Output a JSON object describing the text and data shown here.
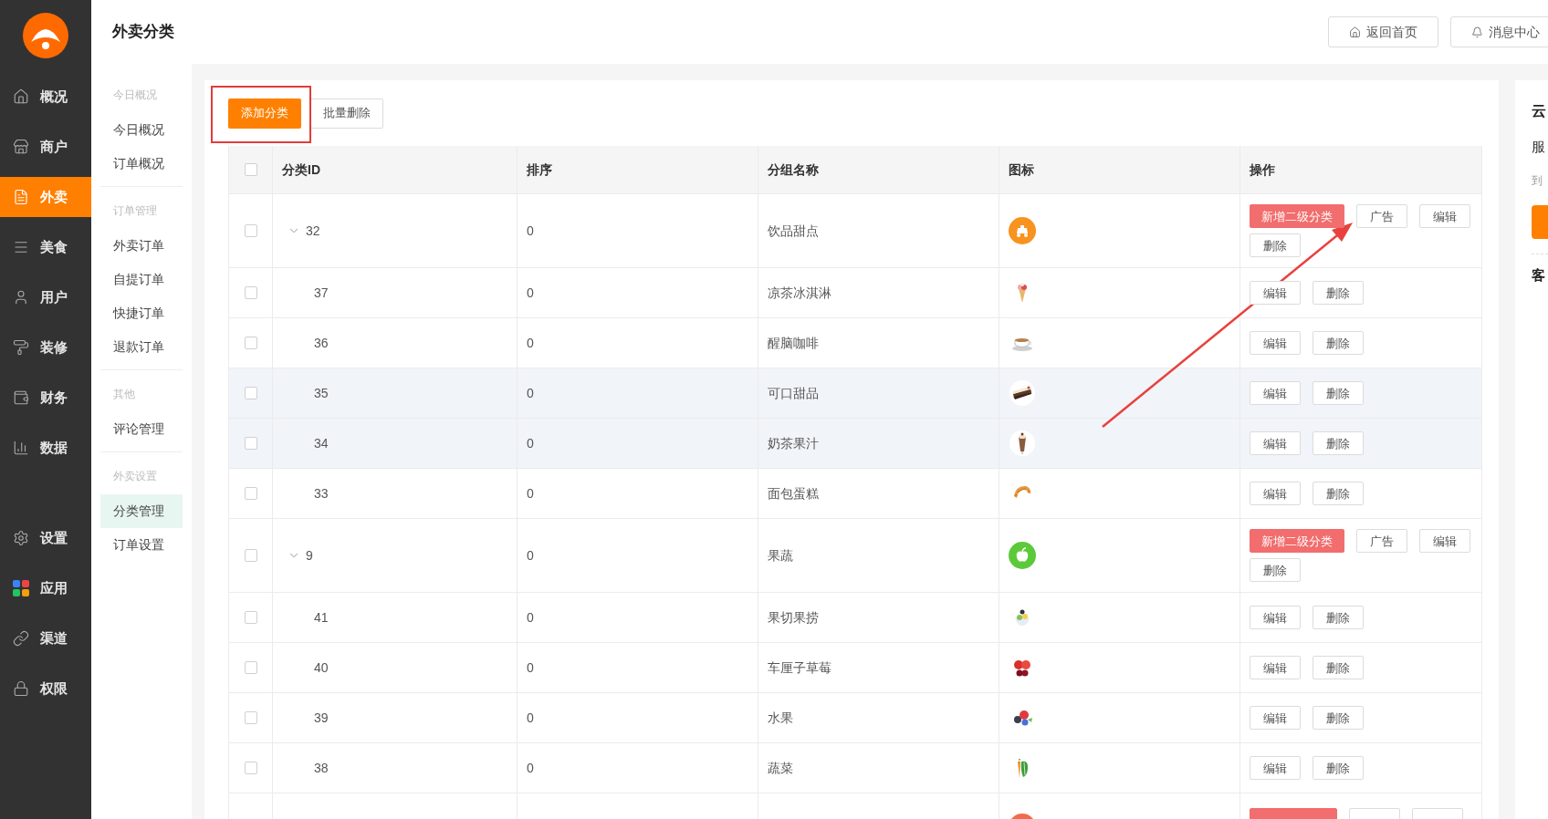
{
  "sidebar": {
    "items": [
      {
        "label": "概况",
        "selected": false
      },
      {
        "label": "商户",
        "selected": false
      },
      {
        "label": "外卖",
        "selected": true
      },
      {
        "label": "美食",
        "selected": false
      },
      {
        "label": "用户",
        "selected": false
      },
      {
        "label": "装修",
        "selected": false
      },
      {
        "label": "财务",
        "selected": false
      },
      {
        "label": "数据",
        "selected": false
      }
    ],
    "bottom_items": [
      {
        "label": "设置",
        "selected": false
      },
      {
        "label": "应用",
        "selected": false
      },
      {
        "label": "渠道",
        "selected": false
      },
      {
        "label": "权限",
        "selected": false
      }
    ]
  },
  "header": {
    "title": "外卖分类",
    "buttons": [
      "返回首页",
      "消息中心"
    ]
  },
  "subnav": [
    {
      "title": "今日概况",
      "items": [
        {
          "label": "今日概况",
          "selected": false
        },
        {
          "label": "订单概况",
          "selected": false
        }
      ]
    },
    {
      "title": "订单管理",
      "items": [
        {
          "label": "外卖订单",
          "selected": false
        },
        {
          "label": "自提订单",
          "selected": false
        },
        {
          "label": "快捷订单",
          "selected": false
        },
        {
          "label": "退款订单",
          "selected": false
        }
      ]
    },
    {
      "title": "其他",
      "items": [
        {
          "label": "评论管理",
          "selected": false
        }
      ]
    },
    {
      "title": "外卖设置",
      "items": [
        {
          "label": "分类管理",
          "selected": true
        },
        {
          "label": "订单设置",
          "selected": false
        }
      ]
    }
  ],
  "toolbar": {
    "add_button": "添加分类",
    "batch_delete_button": "批量删除"
  },
  "table": {
    "columns": [
      "分类ID",
      "排序",
      "分组名称",
      "图标",
      "操作"
    ],
    "header_checked": false,
    "rows": [
      {
        "id": "32",
        "sort": "0",
        "name": "饮品甜点",
        "checked": false,
        "expanded": true,
        "highlighted": false,
        "icon": {
          "kind": "scooter",
          "color": "#f7931e"
        },
        "actions": [
          {
            "label": "新增二级分类",
            "kind": "primary"
          },
          {
            "label": "广告",
            "kind": "default"
          },
          {
            "label": "编辑",
            "kind": "default"
          },
          {
            "label": "删除",
            "kind": "default"
          }
        ],
        "children": [
          {
            "id": "37",
            "sort": "0",
            "name": "凉茶冰淇淋",
            "checked": false,
            "highlighted": false,
            "icon": {
              "kind": "picture"
            },
            "actions": [
              {
                "label": "编辑",
                "kind": "default"
              },
              {
                "label": "删除",
                "kind": "default"
              }
            ]
          },
          {
            "id": "36",
            "sort": "0",
            "name": "醒脑咖啡",
            "checked": false,
            "highlighted": false,
            "icon": {
              "kind": "picture"
            },
            "actions": [
              {
                "label": "编辑",
                "kind": "default"
              },
              {
                "label": "删除",
                "kind": "default"
              }
            ]
          },
          {
            "id": "35",
            "sort": "0",
            "name": "可口甜品",
            "checked": false,
            "highlighted": true,
            "icon": {
              "kind": "picture"
            },
            "actions": [
              {
                "label": "编辑",
                "kind": "default"
              },
              {
                "label": "删除",
                "kind": "default"
              }
            ]
          },
          {
            "id": "34",
            "sort": "0",
            "name": "奶茶果汁",
            "checked": false,
            "highlighted": true,
            "icon": {
              "kind": "picture"
            },
            "actions": [
              {
                "label": "编辑",
                "kind": "default"
              },
              {
                "label": "删除",
                "kind": "default"
              }
            ]
          },
          {
            "id": "33",
            "sort": "0",
            "name": "面包蛋糕",
            "checked": false,
            "highlighted": false,
            "icon": {
              "kind": "picture"
            },
            "actions": [
              {
                "label": "编辑",
                "kind": "default"
              },
              {
                "label": "删除",
                "kind": "default"
              }
            ]
          }
        ]
      },
      {
        "id": "9",
        "sort": "0",
        "name": "果蔬",
        "checked": false,
        "expanded": true,
        "highlighted": false,
        "icon": {
          "kind": "apple",
          "color": "#5cc93a"
        },
        "actions": [
          {
            "label": "新增二级分类",
            "kind": "primary"
          },
          {
            "label": "广告",
            "kind": "default"
          },
          {
            "label": "编辑",
            "kind": "default"
          },
          {
            "label": "删除",
            "kind": "default"
          }
        ],
        "children": [
          {
            "id": "41",
            "sort": "0",
            "name": "果切果捞",
            "checked": false,
            "highlighted": false,
            "icon": {
              "kind": "picture"
            },
            "actions": [
              {
                "label": "编辑",
                "kind": "default"
              },
              {
                "label": "删除",
                "kind": "default"
              }
            ]
          },
          {
            "id": "40",
            "sort": "0",
            "name": "车厘子草莓",
            "checked": false,
            "highlighted": false,
            "icon": {
              "kind": "picture"
            },
            "actions": [
              {
                "label": "编辑",
                "kind": "default"
              },
              {
                "label": "删除",
                "kind": "default"
              }
            ]
          },
          {
            "id": "39",
            "sort": "0",
            "name": "水果",
            "checked": false,
            "highlighted": false,
            "icon": {
              "kind": "picture"
            },
            "actions": [
              {
                "label": "编辑",
                "kind": "default"
              },
              {
                "label": "删除",
                "kind": "default"
              }
            ]
          },
          {
            "id": "38",
            "sort": "0",
            "name": "蔬菜",
            "checked": false,
            "highlighted": false,
            "icon": {
              "kind": "picture"
            },
            "actions": [
              {
                "label": "编辑",
                "kind": "default"
              },
              {
                "label": "删除",
                "kind": "default"
              }
            ]
          }
        ]
      },
      {
        "icon": {
          "kind": "badge",
          "color": "#f26b4b"
        },
        "actions": [
          {
            "kind": "primary"
          },
          {
            "kind": "default"
          },
          {
            "kind": "default"
          }
        ]
      }
    ]
  },
  "right_panel": {
    "title": "云",
    "label": "服",
    "note": "到",
    "section": "客"
  }
}
